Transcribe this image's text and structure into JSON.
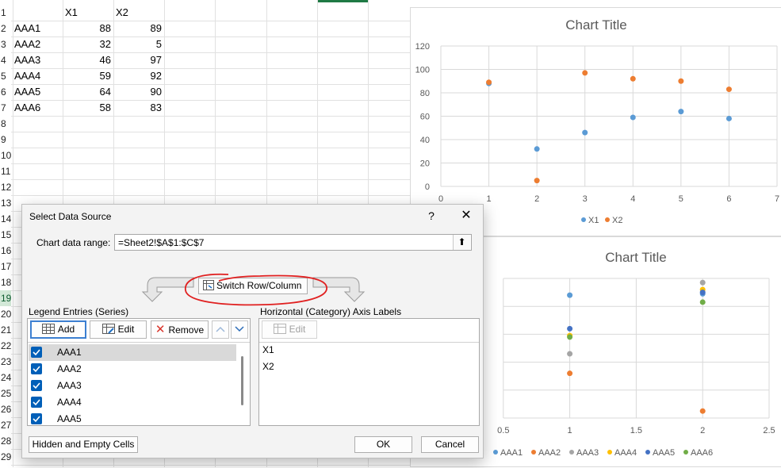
{
  "sheet": {
    "row_numbers": [
      "1",
      "2",
      "3",
      "4",
      "5",
      "6",
      "7",
      "8",
      "9",
      "10",
      "11",
      "12",
      "13",
      "14",
      "15",
      "16",
      "17",
      "18",
      "19",
      "20",
      "21",
      "22",
      "23",
      "24",
      "25",
      "26",
      "27",
      "28",
      "29"
    ],
    "active_row": "19",
    "headers": [
      "",
      "X1",
      "X2"
    ],
    "rows": [
      {
        "name": "AAA1",
        "x1": "88",
        "x2": "89"
      },
      {
        "name": "AAA2",
        "x1": "32",
        "x2": "5"
      },
      {
        "name": "AAA3",
        "x1": "46",
        "x2": "97"
      },
      {
        "name": "AAA4",
        "x1": "59",
        "x2": "92"
      },
      {
        "name": "AAA5",
        "x1": "64",
        "x2": "90"
      },
      {
        "name": "AAA6",
        "x1": "58",
        "x2": "83"
      }
    ]
  },
  "chart_data": [
    {
      "type": "scatter",
      "title": "Chart Title",
      "xlim": [
        0,
        7
      ],
      "ylim": [
        0,
        120
      ],
      "x_ticks": [
        "0",
        "1",
        "2",
        "3",
        "4",
        "5",
        "6",
        "7"
      ],
      "y_ticks": [
        "0",
        "20",
        "40",
        "60",
        "80",
        "100",
        "120"
      ],
      "grid": true,
      "legend_position": "bottom",
      "series": [
        {
          "name": "X1",
          "color": "#5b9bd5",
          "x": [
            1,
            2,
            3,
            4,
            5,
            6
          ],
          "y": [
            88,
            32,
            46,
            59,
            64,
            58
          ]
        },
        {
          "name": "X2",
          "color": "#ed7d31",
          "x": [
            1,
            2,
            3,
            4,
            5,
            6
          ],
          "y": [
            89,
            5,
            97,
            92,
            90,
            83
          ]
        }
      ]
    },
    {
      "type": "scatter",
      "title": "Chart Title",
      "xlim": [
        0,
        2.5
      ],
      "x_ticks": [
        "0.5",
        "1",
        "1.5",
        "2",
        "2.5"
      ],
      "grid": true,
      "legend_position": "bottom",
      "series": [
        {
          "name": "AAA1",
          "color": "#5b9bd5",
          "x": [
            1,
            2
          ],
          "y": [
            88,
            89
          ]
        },
        {
          "name": "AAA2",
          "color": "#ed7d31",
          "x": [
            1,
            2
          ],
          "y": [
            32,
            5
          ]
        },
        {
          "name": "AAA3",
          "color": "#a5a5a5",
          "x": [
            1,
            2
          ],
          "y": [
            46,
            97
          ]
        },
        {
          "name": "AAA4",
          "color": "#ffc000",
          "x": [
            1,
            2
          ],
          "y": [
            59,
            92
          ]
        },
        {
          "name": "AAA5",
          "color": "#4472c4",
          "x": [
            1,
            2
          ],
          "y": [
            64,
            90
          ]
        },
        {
          "name": "AAA6",
          "color": "#70ad47",
          "x": [
            1,
            2
          ],
          "y": [
            58,
            83
          ]
        }
      ]
    }
  ],
  "dialog": {
    "title": "Select Data Source",
    "help": "?",
    "close": "✕",
    "range_label": "Chart data range:",
    "range_value": "=Sheet2!$A$1:$C$7",
    "collapse_icon": "⬆",
    "switch_label": "Switch Row/Column",
    "legend_label": "Legend Entries (Series)",
    "axis_label": "Horizontal (Category) Axis Labels",
    "add_label": "Add",
    "edit_label": "Edit",
    "remove_label": "Remove",
    "axis_edit_label": "Edit",
    "series": [
      "AAA1",
      "AAA2",
      "AAA3",
      "AAA4",
      "AAA5"
    ],
    "selected_series": "AAA1",
    "axis_labels": [
      "X1",
      "X2"
    ],
    "hidden_cells_label": "Hidden and Empty Cells",
    "ok_label": "OK",
    "cancel_label": "Cancel"
  },
  "annotation": {
    "color": "#e02020"
  }
}
